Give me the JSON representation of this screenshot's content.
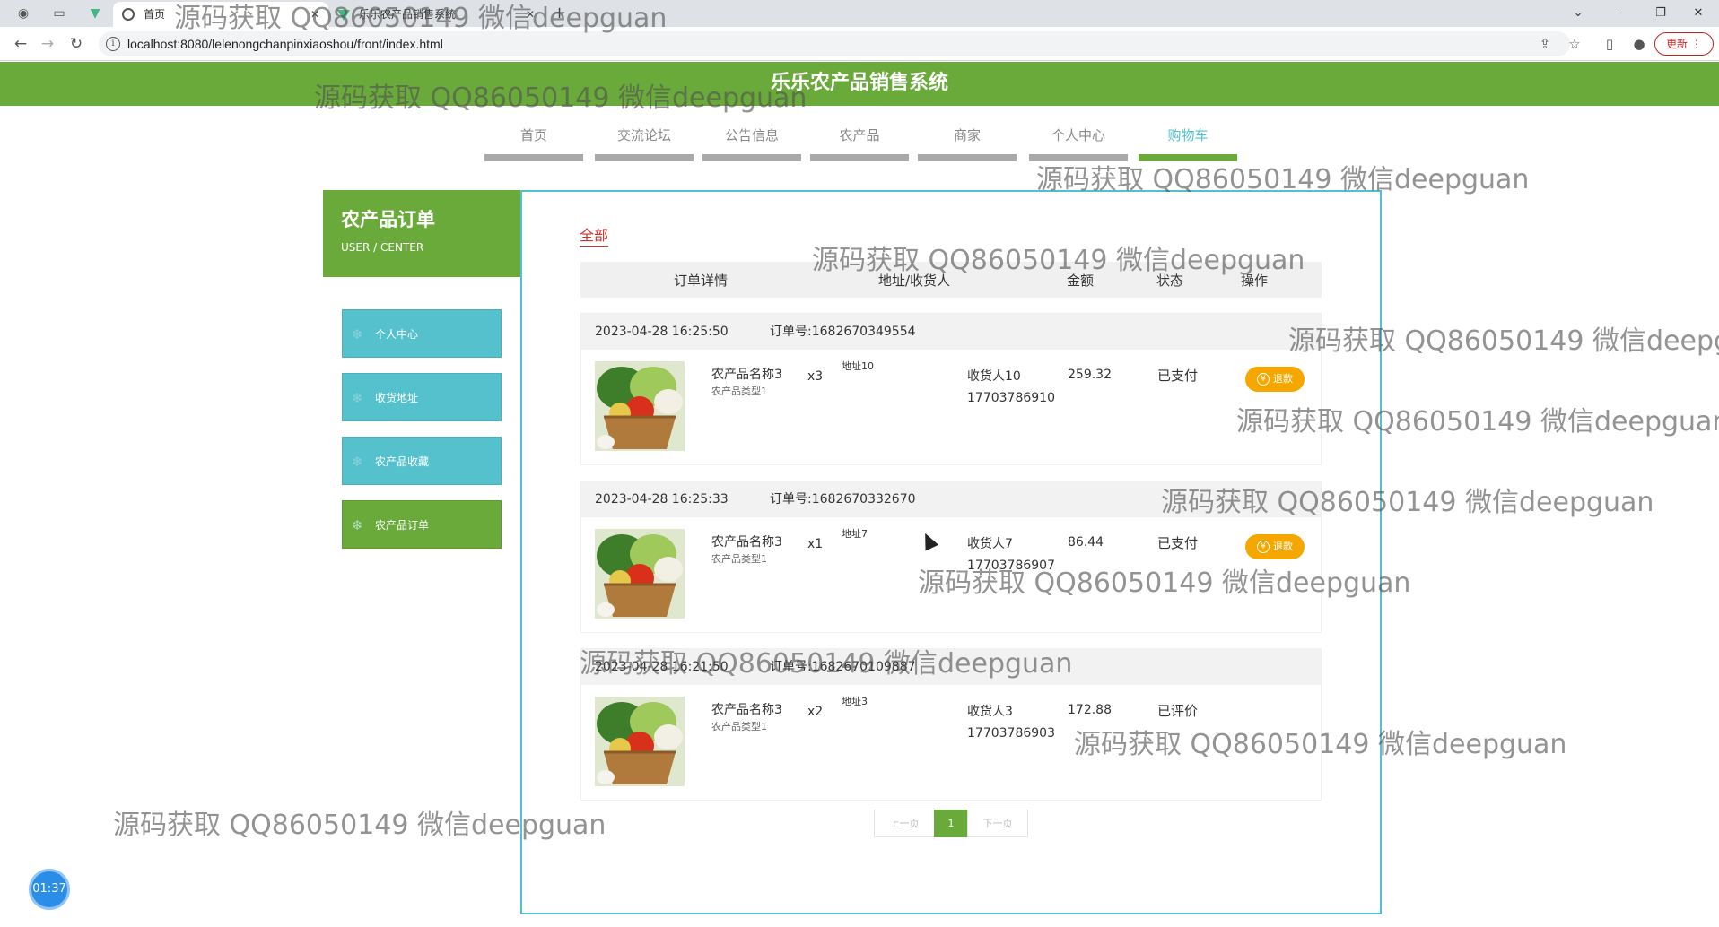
{
  "browser": {
    "tabs": [
      {
        "title": "首页",
        "active": true
      },
      {
        "title": "乐乐农产品销售系统",
        "active": false
      }
    ],
    "url": "localhost:8080/lelenongchanpinxiaoshou/front/index.html",
    "update_label": "更新"
  },
  "site": {
    "title": "乐乐农产品销售系统",
    "nav": [
      "首页",
      "交流论坛",
      "公告信息",
      "农产品",
      "商家",
      "个人中心",
      "购物车"
    ],
    "active_nav": "购物车"
  },
  "sidebar": {
    "title": "农产品订单",
    "subtitle": "USER / CENTER",
    "items": [
      {
        "label": "个人中心"
      },
      {
        "label": "收货地址"
      },
      {
        "label": "农产品收藏"
      },
      {
        "label": "农产品订单"
      }
    ],
    "active_item": "农产品订单"
  },
  "orders_page": {
    "filter_label": "全部",
    "columns": [
      "订单详情",
      "地址/收货人",
      "金额",
      "状态",
      "操作"
    ],
    "orders": [
      {
        "date": "2023-04-28 16:25:50",
        "order_no": "订单号:1682670349554",
        "product_name": "农产品名称3",
        "product_type": "农产品类型1",
        "qty": "x3",
        "address": "地址10",
        "receiver": "收货人10",
        "phone": "17703786910",
        "amount": "259.32",
        "status": "已支付",
        "action": "退款"
      },
      {
        "date": "2023-04-28 16:25:33",
        "order_no": "订单号:1682670332670",
        "product_name": "农产品名称3",
        "product_type": "农产品类型1",
        "qty": "x1",
        "address": "地址7",
        "receiver": "收货人7",
        "phone": "17703786907",
        "amount": "86.44",
        "status": "已支付",
        "action": "退款"
      },
      {
        "date": "2023-04-28 16:21:50",
        "order_no": "订单号:1682670109887",
        "product_name": "农产品名称3",
        "product_type": "农产品类型1",
        "qty": "x2",
        "address": "地址3",
        "receiver": "收货人3",
        "phone": "17703786903",
        "amount": "172.88",
        "status": "已评价",
        "action": ""
      }
    ],
    "pagination": {
      "prev": "上一页",
      "current": "1",
      "next": "下一页"
    }
  },
  "timer": "01:37",
  "watermark": "源码获取 QQ86050149 微信deepguan",
  "colors": {
    "brand_green": "#6aaa3b",
    "sidebar_teal": "#55c1cd",
    "refund_orange": "#f5a700",
    "filter_red": "#d6302a"
  }
}
